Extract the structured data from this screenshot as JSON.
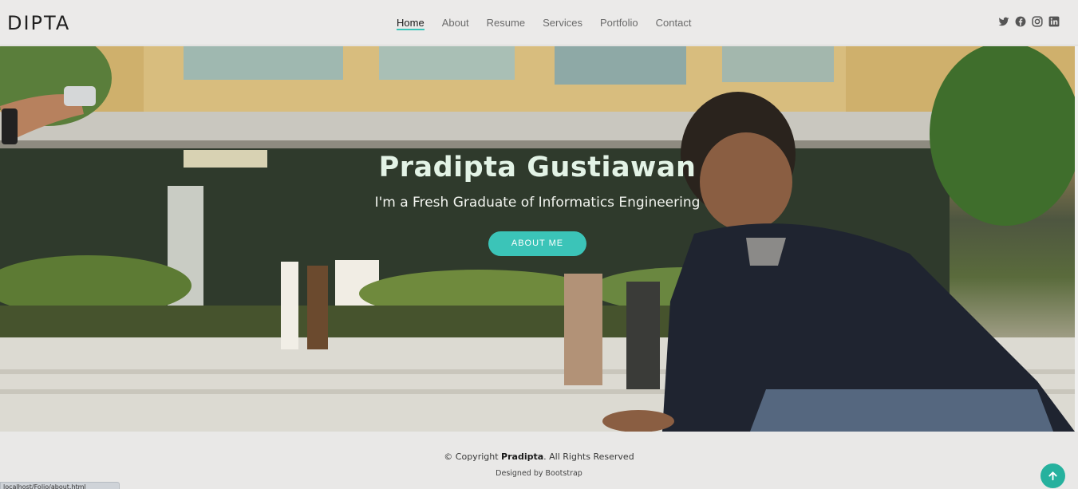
{
  "header": {
    "logo": "DIPTA",
    "nav": [
      {
        "label": "Home",
        "active": true
      },
      {
        "label": "About",
        "active": false
      },
      {
        "label": "Resume",
        "active": false
      },
      {
        "label": "Services",
        "active": false
      },
      {
        "label": "Portfolio",
        "active": false
      },
      {
        "label": "Contact",
        "active": false
      }
    ],
    "socials": [
      "twitter-icon",
      "facebook-icon",
      "instagram-icon",
      "linkedin-icon"
    ]
  },
  "hero": {
    "title": "Pradipta Gustiawan",
    "subtitle": "I'm a Fresh Graduate of Informatics Engineering",
    "button_label": "ABOUT ME"
  },
  "footer": {
    "copyright_prefix": "© Copyright ",
    "copyright_name": "Pradipta",
    "copyright_suffix": ". All Rights Reserved",
    "designed_by": "Designed by Bootstrap"
  },
  "status_bar": {
    "url": "localhost/Folio/about.html"
  },
  "colors": {
    "accent": "#3bc4b8",
    "back_to_top": "#26b19e",
    "header_bg": "#ebeae9"
  }
}
